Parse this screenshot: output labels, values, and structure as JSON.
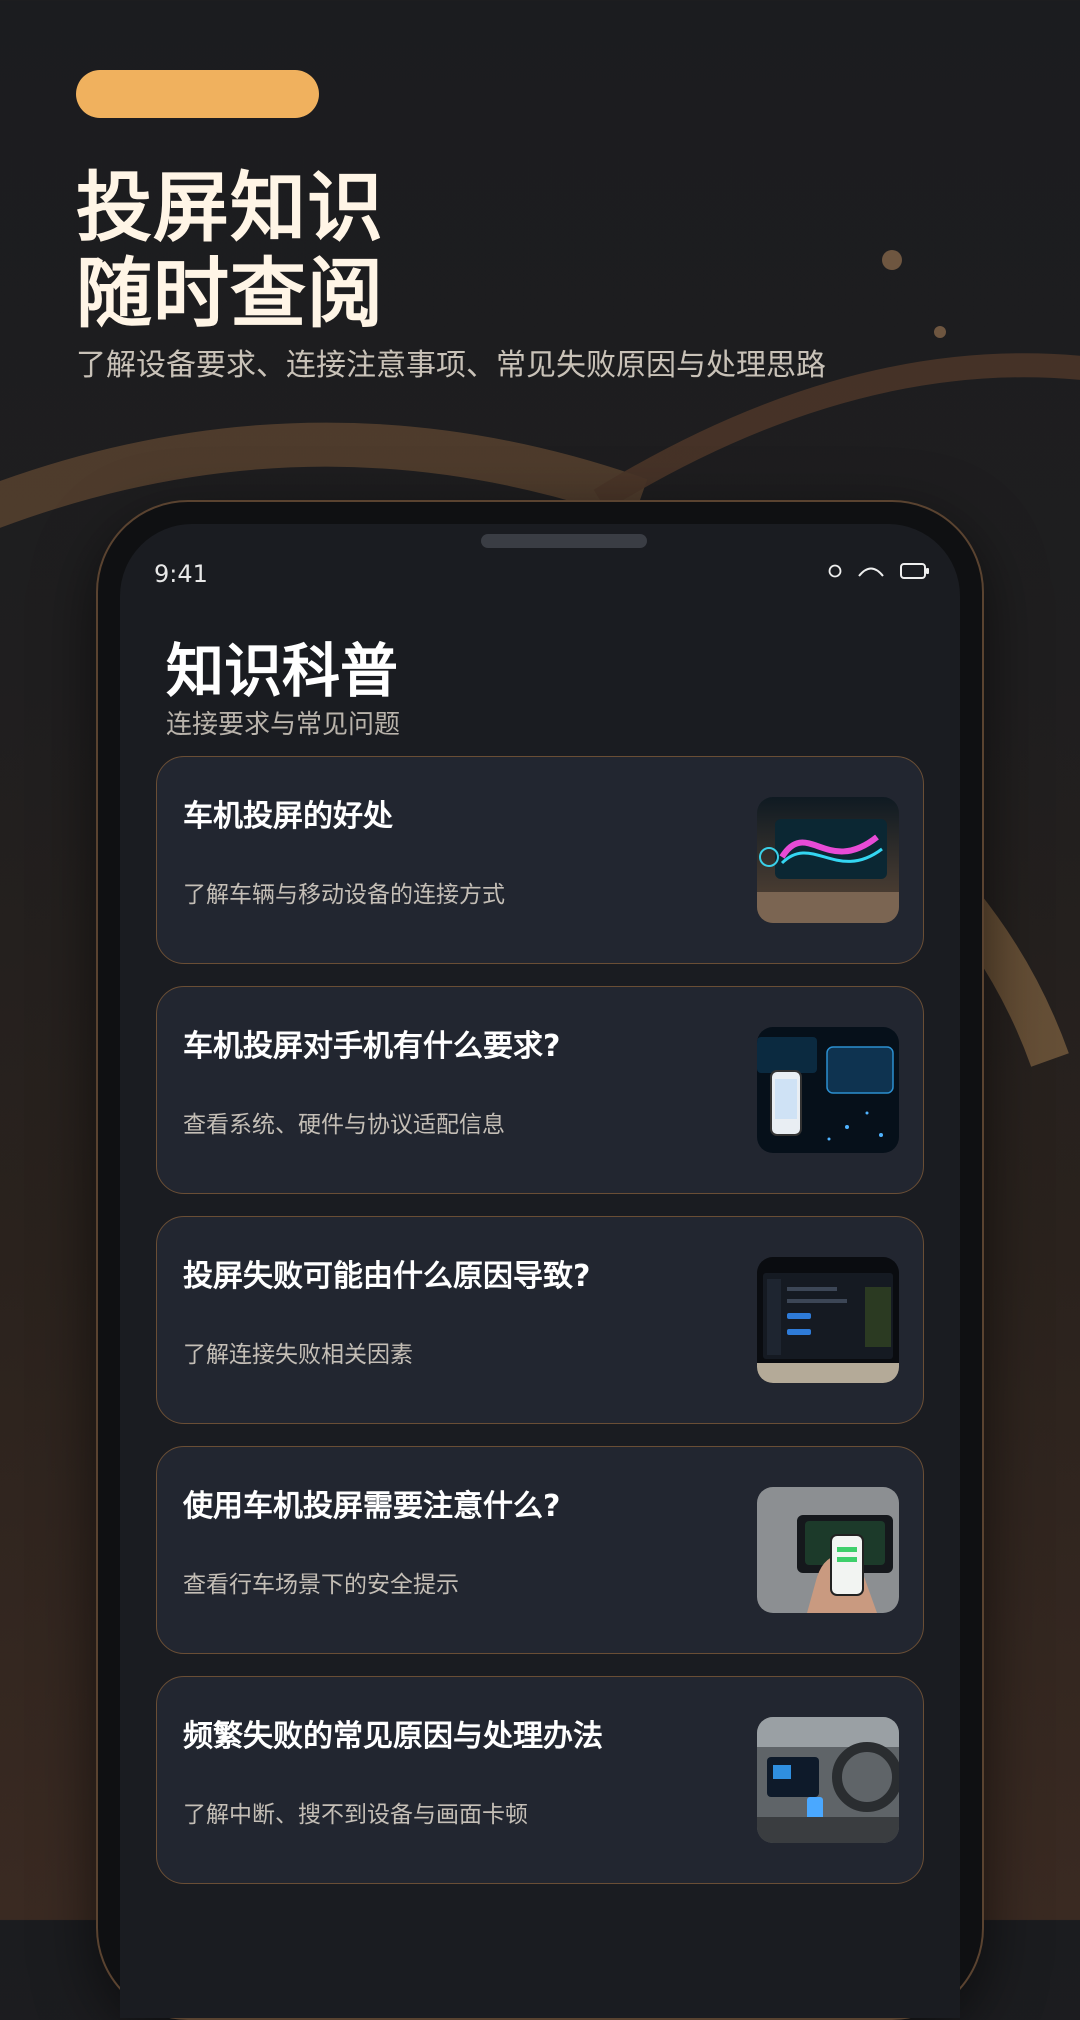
{
  "hero": {
    "title_line1": "投屏知识",
    "title_line2": "随时查阅",
    "subtitle": "了解设备要求、连接注意事项、常见失败原因与处理思路",
    "accent_color": "#f0b15e"
  },
  "status_bar": {
    "time": "9:41",
    "icons": [
      "circle-icon",
      "wifi-icon",
      "battery-icon"
    ]
  },
  "page": {
    "title": "知识科普",
    "subtitle": "连接要求与常见问题"
  },
  "cards": [
    {
      "title": "车机投屏的好处",
      "description": "了解车辆与移动设备的连接方式",
      "image": "car-dashboard-image"
    },
    {
      "title": "车机投屏对手机有什么要求?",
      "description": "查看系统、硬件与协议适配信息",
      "image": "phone-and-car-screen-image"
    },
    {
      "title": "投屏失败可能由什么原因导致?",
      "description": "了解连接失败相关因素",
      "image": "car-infotainment-screen-image"
    },
    {
      "title": "使用车机投屏需要注意什么?",
      "description": "查看行车场景下的安全提示",
      "image": "hand-holding-phone-image"
    },
    {
      "title": "频繁失败的常见原因与处理办法",
      "description": "了解中断、搜不到设备与画面卡顿",
      "image": "car-interior-image"
    }
  ],
  "colors": {
    "background": "#1b1c1f",
    "card_background": "#222630",
    "card_border": "#6a4e35"
  }
}
